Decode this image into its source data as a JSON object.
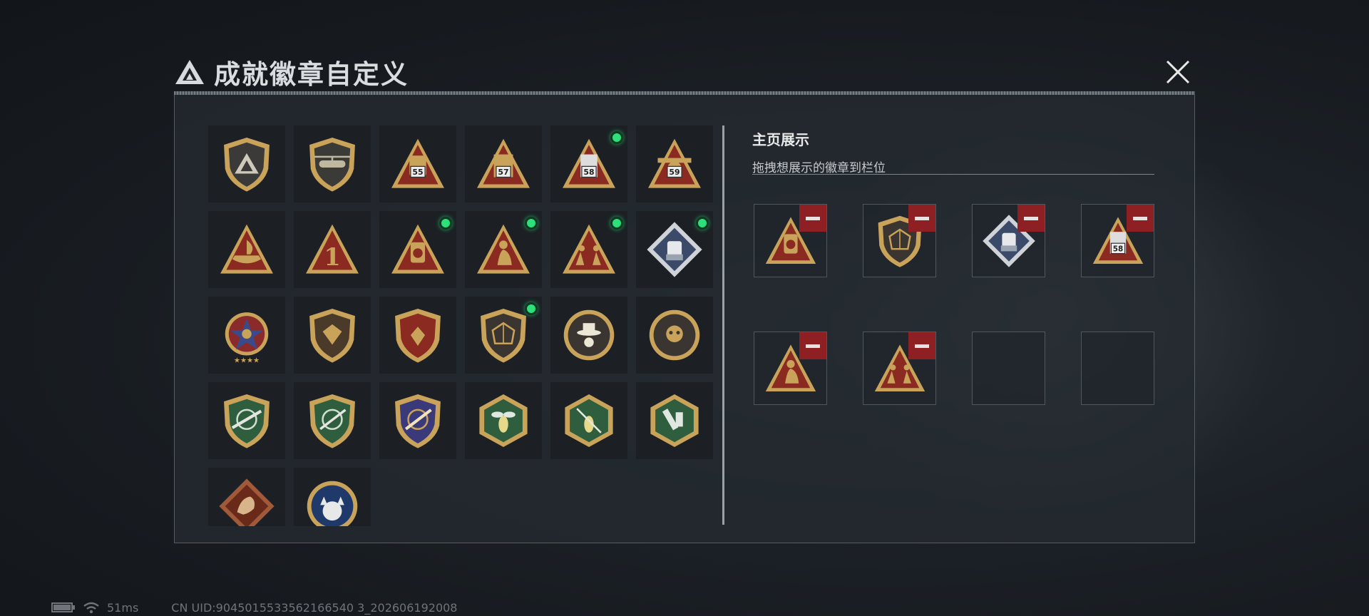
{
  "window": {
    "title": "成就徽章自定义"
  },
  "display_panel": {
    "title": "主页展示",
    "subtitle": "拖拽想展示的徽章到栏位"
  },
  "status_bar": {
    "latency": "51ms",
    "uid": "CN UID:9045015533562166540 3_202606192008"
  },
  "colors": {
    "accent_new": "#2ee07a",
    "remove_red": "#8e1f22",
    "badge_gold": "#c9a35a",
    "badge_red": "#8a2a20",
    "badge_green": "#2f5e3e"
  },
  "badges": [
    {
      "icon": "shield-delta-icon",
      "new": false
    },
    {
      "icon": "helicopter-shield-icon",
      "new": false
    },
    {
      "icon": "triangle-55-icon",
      "new": false
    },
    {
      "icon": "triangle-57-icon",
      "new": false
    },
    {
      "icon": "triangle-58-icon",
      "new": true
    },
    {
      "icon": "triangle-59-icon",
      "new": false
    },
    {
      "icon": "triangle-boat-icon",
      "new": false
    },
    {
      "icon": "triangle-number-one-icon",
      "new": false
    },
    {
      "icon": "triangle-mask-icon",
      "new": true
    },
    {
      "icon": "triangle-figure-icon",
      "new": true
    },
    {
      "icon": "triangle-soldiers-icon",
      "new": true
    },
    {
      "icon": "diamond-fist-icon",
      "new": true
    },
    {
      "icon": "star-medal-icon",
      "new": false
    },
    {
      "icon": "shield-crest-icon",
      "new": false
    },
    {
      "icon": "winged-crest-icon",
      "new": false
    },
    {
      "icon": "shield-d20-icon",
      "new": true
    },
    {
      "icon": "round-hat-icon",
      "new": false
    },
    {
      "icon": "round-skull-icon",
      "new": false
    },
    {
      "icon": "green-crosshair-rifle-icon",
      "new": false
    },
    {
      "icon": "green-crosshair-knife-icon",
      "new": false
    },
    {
      "icon": "gold-crosshair-icon",
      "new": false
    },
    {
      "icon": "hex-wasp-icon",
      "new": false
    },
    {
      "icon": "hex-wasp-knife-icon",
      "new": false
    },
    {
      "icon": "hex-tools-icon",
      "new": false
    },
    {
      "icon": "diamond-dragon-icon",
      "new": false
    },
    {
      "icon": "round-lynx-icon",
      "new": false
    }
  ],
  "display_slots": [
    {
      "icon": "triangle-mask-icon",
      "filled": true
    },
    {
      "icon": "shield-d20-icon",
      "filled": true
    },
    {
      "icon": "diamond-fist-icon",
      "filled": true
    },
    {
      "icon": "triangle-58-icon",
      "filled": true
    },
    {
      "icon": "triangle-figure-icon",
      "filled": true
    },
    {
      "icon": "triangle-soldiers-icon",
      "filled": true
    },
    {
      "icon": "",
      "filled": false
    },
    {
      "icon": "",
      "filled": false
    }
  ],
  "badge_numbers": {
    "triangle-55-icon": "55",
    "triangle-57-icon": "57",
    "triangle-58-icon": "58",
    "triangle-59-icon": "59",
    "triangle-number-one-icon": "1"
  }
}
